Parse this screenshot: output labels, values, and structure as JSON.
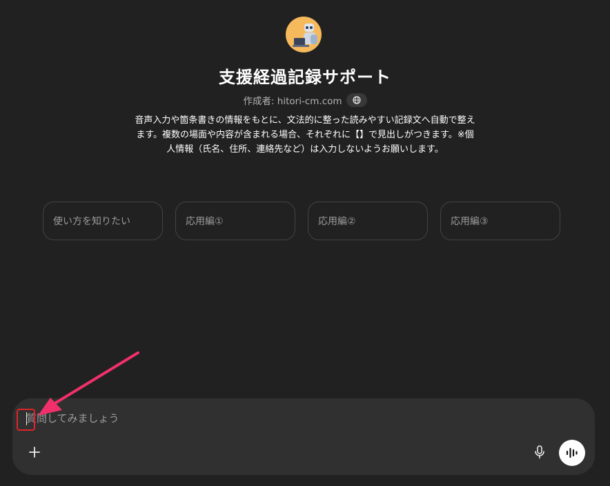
{
  "gpt": {
    "title": "支援経過記録サポート",
    "author_label": "作成者: hitori-cm.com",
    "description": "音声入力や箇条書きの情報をもとに、文法的に整った読みやすい記録文へ自動で整えます。複数の場面や内容が含まれる場合、それぞれに【】で見出しがつきます。※個人情報（氏名、住所、連絡先など）は入力しないようお願いします。",
    "avatar_icon": "robot-laptop-avatar",
    "globe_icon": "globe-icon"
  },
  "suggestions": [
    {
      "label": "使い方を知りたい"
    },
    {
      "label": "応用編①"
    },
    {
      "label": "応用編②"
    },
    {
      "label": "応用編③"
    }
  ],
  "composer": {
    "placeholder": "質問してみましょう",
    "plus_icon": "plus-icon",
    "mic_icon": "microphone-icon",
    "voice_icon": "voice-mode-icon"
  },
  "annotation": {
    "arrow_color": "#f0306a",
    "box_color": "#e0242a"
  }
}
